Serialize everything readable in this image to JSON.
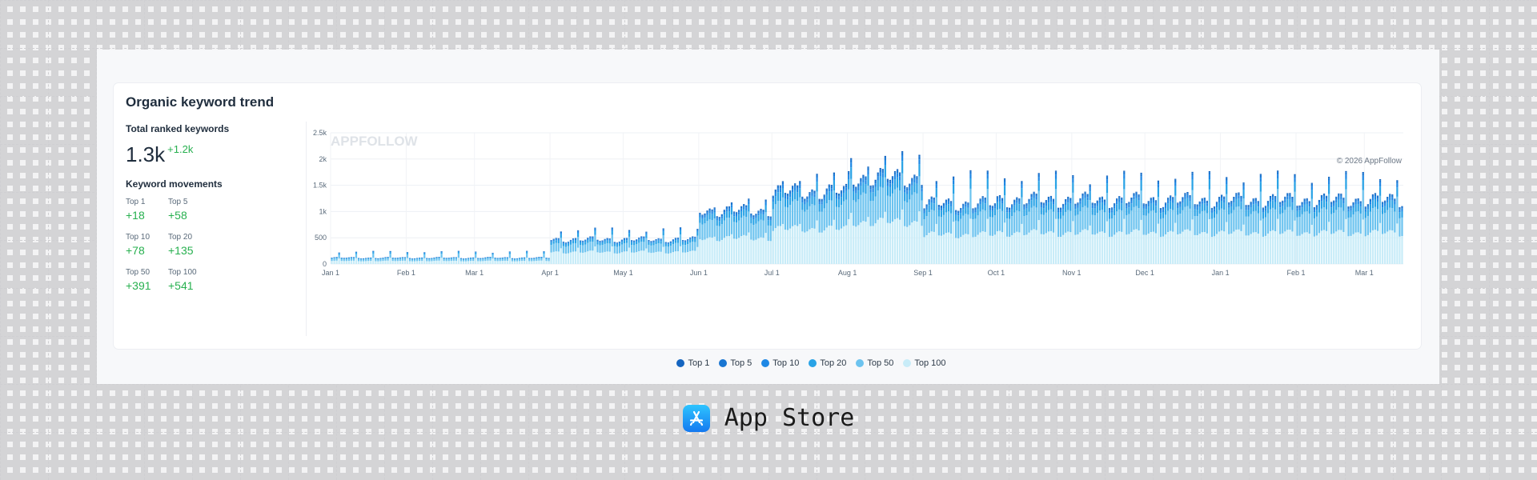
{
  "card": {
    "title": "Organic keyword trend",
    "total_label": "Total ranked keywords",
    "total_value": "1.3k",
    "total_delta": "+1.2k",
    "movements_title": "Keyword movements",
    "movements": [
      {
        "label": "Top 1",
        "value": "+18"
      },
      {
        "label": "Top 5",
        "value": "+58"
      },
      {
        "label": "Top 10",
        "value": "+78"
      },
      {
        "label": "Top 20",
        "value": "+135"
      },
      {
        "label": "Top 50",
        "value": "+391"
      },
      {
        "label": "Top 100",
        "value": "+541"
      }
    ]
  },
  "footer": {
    "label": "App Store",
    "icon": "app-store-icon"
  },
  "colors": {
    "accent_green": "#27b04f",
    "top1": "#1565c0",
    "top5": "#1976d2",
    "top10": "#1e88e5",
    "top20": "#29a3e6",
    "top50": "#6cc3ef",
    "top100": "#c8ecf8"
  },
  "chart_data": {
    "type": "bar",
    "stacked": true,
    "watermark": "APPFOLLOW",
    "copyright": "© 2026 AppFollow",
    "y_ticks": [
      "0",
      "500",
      "1k",
      "1.5k",
      "2k",
      "2.5k"
    ],
    "ylim": [
      0,
      2500
    ],
    "x_ticks": [
      "Jan 1",
      "Feb 1",
      "Mar 1",
      "Apr 1",
      "May 1",
      "Jun 1",
      "Jul 1",
      "Aug 1",
      "Sep 1",
      "Oct 1",
      "Nov 1",
      "Dec 1",
      "Jan 1",
      "Feb 1",
      "Mar 1"
    ],
    "legend": [
      "Top 1",
      "Top 5",
      "Top 10",
      "Top 20",
      "Top 50",
      "Top 100"
    ],
    "grid": true,
    "periods": [
      {
        "start": "Jan 1",
        "end": "Mar 31",
        "total": 120,
        "spike": 250
      },
      {
        "start": "Apr 1",
        "end": "May 31",
        "total": 470,
        "spike": 700
      },
      {
        "start": "Jun 1",
        "end": "Jun 30",
        "total": 1020,
        "spike": 1250
      },
      {
        "start": "Jul 1",
        "end": "Jul 31",
        "total": 1380,
        "spike": 1750
      },
      {
        "start": "Aug 1",
        "end": "Aug 31",
        "total": 1650,
        "spike": 2150
      },
      {
        "start": "Sep 1",
        "end": "Sep 30",
        "total": 1150,
        "spike": 1800
      },
      {
        "start": "Oct 1",
        "end": "Mar 15",
        "total": 1220,
        "spike": 1780
      }
    ],
    "composition": {
      "Top 1": 0.012,
      "Top 5": 0.03,
      "Top 10": 0.045,
      "Top 20": 0.11,
      "Top 50": 0.32,
      "Top 100": 0.483
    }
  }
}
